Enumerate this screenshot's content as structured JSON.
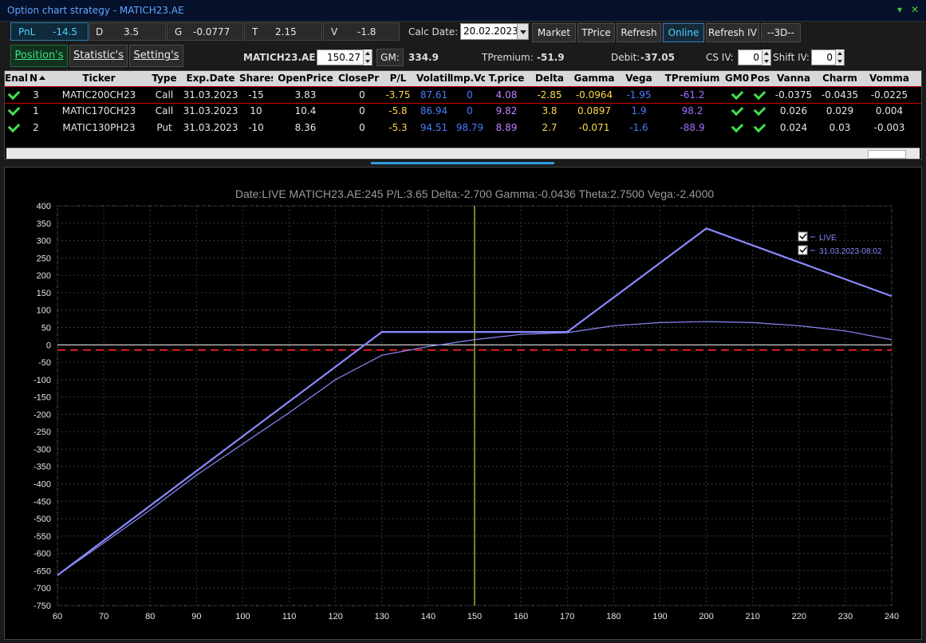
{
  "window": {
    "title": "Option chart strategy - MATICH23.AE",
    "minimize": "▾",
    "close": "✕"
  },
  "greeks": {
    "pnl_label": "PnL",
    "pnl_value": "-14.5",
    "d_label": "D",
    "d_value": "3.5",
    "g_label": "G",
    "g_value": "-0.0777",
    "t_label": "T",
    "t_value": "2.15",
    "v_label": "V",
    "v_value": "-1.8"
  },
  "toolbar": {
    "calc_date_label": "Calc Date:",
    "calc_date_value": "20.02.2023",
    "market": "Market",
    "tprice": "TPrice",
    "refresh": "Refresh",
    "online": "Online",
    "refresh_iv": "Refresh IV",
    "three_d": "--3D--"
  },
  "tabs": {
    "positions": "Position's",
    "statistics": "Statistic's",
    "settings": "Setting's"
  },
  "info": {
    "ticker": "MATICH23.AE",
    "price": "150.27",
    "gm_label": "GM:",
    "gm_value": "334.9",
    "tpremium_label": "TPremium:",
    "tpremium_value": "-51.9",
    "debit_label": "Debit:",
    "debit_value": "-37.05",
    "csiv_label": "CS IV:",
    "csiv_value": "0",
    "shiftiv_label": "Shift IV:",
    "shiftiv_value": "0"
  },
  "table": {
    "columns": [
      "Enal",
      "N",
      "Ticker",
      "Type",
      "Exp.Date",
      "Shares",
      "OpenPrice",
      "ClosePri",
      "P/L",
      "Volatili",
      "Imp.Vo",
      "T.price",
      "Delta",
      "Gamma",
      "Vega",
      "TPremium",
      "GM0",
      "Pos",
      "Vanna",
      "Charm",
      "Vomma"
    ],
    "rows": [
      {
        "n": "3",
        "ticker": "MATIC200CH23",
        "type": "Call",
        "exp": "31.03.2023",
        "shares": "-15",
        "open": "3.83",
        "close": "0",
        "pl": "-3.75",
        "vol": "87.61",
        "impvol": "0",
        "tprice": "4.08",
        "delta": "-2.85",
        "gamma": "-0.0964",
        "vega": "-1.95",
        "tprem": "-61.2",
        "vanna": "-0.0375",
        "charm": "-0.0435",
        "vomma": "-0.0225"
      },
      {
        "n": "1",
        "ticker": "MATIC170CH23",
        "type": "Call",
        "exp": "31.03.2023",
        "shares": "10",
        "open": "10.4",
        "close": "0",
        "pl": "-5.8",
        "vol": "86.94",
        "impvol": "0",
        "tprice": "9.82",
        "delta": "3.8",
        "gamma": "0.0897",
        "vega": "1.9",
        "tprem": "98.2",
        "vanna": "0.026",
        "charm": "0.029",
        "vomma": "0.004"
      },
      {
        "n": "2",
        "ticker": "MATIC130PH23",
        "type": "Put",
        "exp": "31.03.2023",
        "shares": "-10",
        "open": "8.36",
        "close": "0",
        "pl": "-5.3",
        "vol": "94.51",
        "impvol": "98.79",
        "tprice": "8.89",
        "delta": "2.7",
        "gamma": "-0.071",
        "vega": "-1.6",
        "tprem": "-88.9",
        "vanna": "0.024",
        "charm": "0.03",
        "vomma": "-0.003"
      }
    ]
  },
  "colors": {
    "accent": "#4fd0ff",
    "pl": "#ffd84a",
    "vol": "#4a7dff",
    "tprice": "#c080ff",
    "delta": "#ffd84a",
    "vega": "#4a7dff",
    "tprem": "#a070ff",
    "check": "#3fe04f",
    "line": "#8a8aff",
    "zero": "#ffffff",
    "breakeven": "#e02020",
    "cursor": "#e8ff5a"
  },
  "chart_data": {
    "type": "line",
    "title": "Date:LIVE  MATICH23.AE:245  P/L:3.65  Delta:-2.700  Gamma:-0.0436  Theta:2.7500  Vega:-2.4000",
    "xlim": [
      60,
      240
    ],
    "ylim": [
      -750,
      400
    ],
    "xticks": [
      60,
      70,
      80,
      90,
      100,
      110,
      120,
      130,
      140,
      150,
      160,
      170,
      180,
      190,
      200,
      210,
      220,
      230,
      240
    ],
    "yticks": [
      400,
      350,
      300,
      250,
      200,
      150,
      100,
      50,
      0,
      -50,
      -100,
      -150,
      -200,
      -250,
      -300,
      -350,
      -400,
      -450,
      -500,
      -550,
      -600,
      -650,
      -700,
      -750
    ],
    "legend_position": "top-right",
    "grid": true,
    "cursor_x": 150,
    "breakeven_y": -15,
    "series": [
      {
        "name": "LIVE",
        "x": [
          60,
          70,
          80,
          90,
          100,
          110,
          120,
          130,
          140,
          150,
          160,
          170,
          180,
          190,
          200,
          210,
          220,
          230,
          240
        ],
        "y": [
          -663,
          -570,
          -475,
          -375,
          -285,
          -195,
          -100,
          -30,
          -5,
          15,
          30,
          35,
          55,
          64,
          67,
          64,
          55,
          40,
          15
        ]
      },
      {
        "name": "31.03.2023-08:02",
        "x": [
          60,
          130,
          170,
          200,
          240
        ],
        "y": [
          -663,
          37,
          37,
          335,
          140
        ]
      }
    ]
  }
}
